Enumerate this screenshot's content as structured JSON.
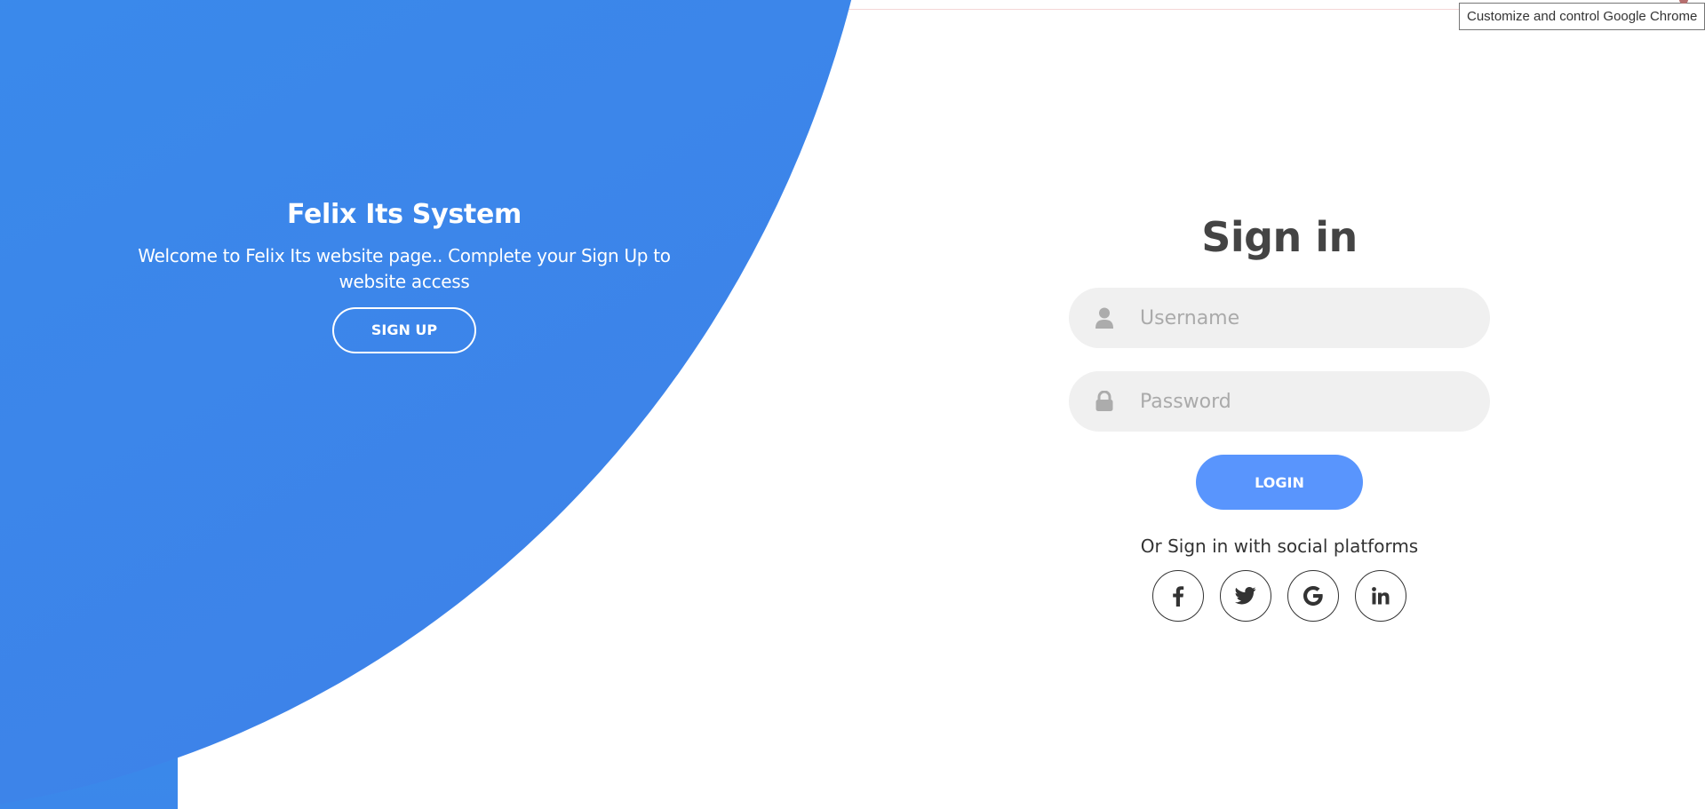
{
  "left_panel": {
    "title": "Felix Its System",
    "description": "Welcome to Felix Its website page.. Complete your Sign Up to website access",
    "signup_label": "SIGN UP"
  },
  "signin": {
    "title": "Sign in",
    "username_placeholder": "Username",
    "password_placeholder": "Password",
    "login_label": "LOGIN",
    "social_text": "Or Sign in with social platforms",
    "social_platforms": [
      "facebook-icon",
      "twitter-icon",
      "google-icon",
      "linkedin-icon"
    ]
  },
  "browser": {
    "tooltip": "Customize and control Google Chrome"
  },
  "colors": {
    "panel_blue": "#3b8bec",
    "login_button": "#5995fd",
    "input_bg": "#f0f0f0",
    "title_text": "#444444"
  }
}
